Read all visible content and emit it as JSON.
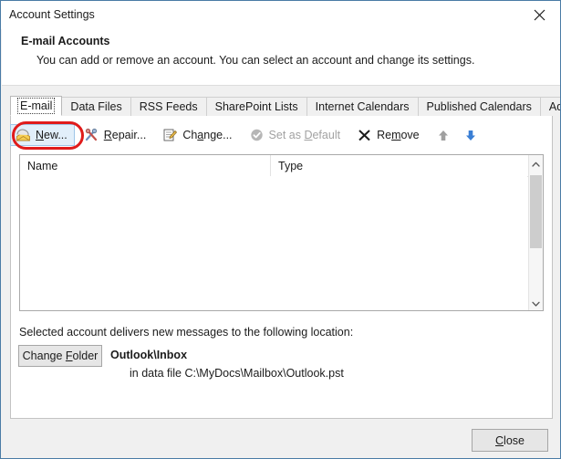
{
  "window": {
    "title": "Account Settings",
    "close_icon": "close-x-icon"
  },
  "header": {
    "title": "E-mail Accounts",
    "description": "You can add or remove an account. You can select an account and change its settings."
  },
  "tabs": [
    {
      "label": "E-mail",
      "selected": true
    },
    {
      "label": "Data Files",
      "selected": false
    },
    {
      "label": "RSS Feeds",
      "selected": false
    },
    {
      "label": "SharePoint Lists",
      "selected": false
    },
    {
      "label": "Internet Calendars",
      "selected": false
    },
    {
      "label": "Published Calendars",
      "selected": false
    },
    {
      "label": "Address Books",
      "selected": false
    }
  ],
  "toolbar": {
    "new": {
      "label_pre": "",
      "accel": "N",
      "label_post": "ew...",
      "icon": "new-mail-envelope-icon",
      "state": "hover",
      "highlighted": true
    },
    "repair": {
      "label_pre": "",
      "accel": "R",
      "label_post": "epair...",
      "icon": "repair-tools-icon",
      "state": "enabled"
    },
    "change": {
      "label_pre": "Ch",
      "accel": "a",
      "label_post": "nge...",
      "icon": "change-clipboard-pencil-icon",
      "state": "enabled"
    },
    "set_as_default": {
      "label_pre": "Set as ",
      "accel": "D",
      "label_post": "efault",
      "icon": "check-circle-icon",
      "state": "disabled"
    },
    "remove": {
      "label_pre": "Re",
      "accel": "m",
      "label_post": "ove",
      "icon": "remove-x-icon",
      "state": "enabled"
    },
    "move_up": {
      "icon": "arrow-up-icon",
      "state": "disabled"
    },
    "move_down": {
      "icon": "arrow-down-icon",
      "state": "enabled"
    }
  },
  "account_list": {
    "columns": [
      "Name",
      "Type"
    ],
    "rows": [],
    "scrollbar": {
      "up_icon": "chevron-up-icon",
      "down_icon": "chevron-down-icon"
    }
  },
  "delivery": {
    "label": "Selected account delivers new messages to the following location:",
    "change_folder": {
      "label_pre": "Change ",
      "accel": "F",
      "label_post": "older"
    },
    "folder_name": "Outlook\\Inbox",
    "folder_path": "in data file C:\\MyDocs\\Mailbox\\Outlook.pst"
  },
  "footer": {
    "close": {
      "label_pre": "",
      "accel": "C",
      "label_post": "lose"
    }
  },
  "colors": {
    "window_border": "#4a7ba6",
    "dialog_background": "#f0f0f0",
    "panel_background": "#ffffff",
    "annotation": "#e01b1b",
    "hover_highlight": "#e2effa",
    "hover_border": "#9fc6e8",
    "disabled_text": "#a2a2a2",
    "arrow_enabled": "#3a7fd5",
    "arrow_disabled": "#a0a0a0"
  }
}
